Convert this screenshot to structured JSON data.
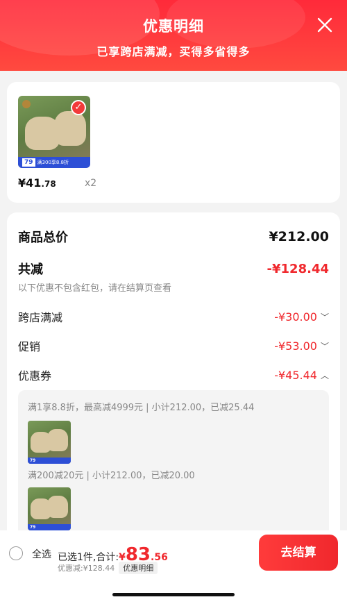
{
  "header": {
    "title": "优惠明细",
    "subtitle": "已享跨店满减，买得多省得多"
  },
  "product": {
    "price_int": "¥41",
    "price_dec": ".78",
    "quantity": "x2",
    "badge_price": "79",
    "badge_text": "满300享8.8折",
    "selected": true
  },
  "summary": {
    "total_label": "商品总价",
    "total_value": "¥212.00",
    "reduce_label": "共减",
    "reduce_value": "-¥128.44",
    "note": "以下优惠不包含红包，请在结算页查看",
    "items": [
      {
        "label": "跨店满减",
        "value": "-¥30.00",
        "chevron": "chevron-down"
      },
      {
        "label": "促销",
        "value": "-¥53.00",
        "chevron": "chevron-down"
      },
      {
        "label": "优惠券",
        "value": "-¥45.44",
        "chevron": "chevron-up"
      }
    ]
  },
  "coupons": [
    {
      "text": "满1享8.8折，最高减4999元 | 小计212.00，已减25.44",
      "thumb_price": "79"
    },
    {
      "text": "满200减20元 | 小计212.00，已减20.00",
      "thumb_price": "79"
    }
  ],
  "bottom": {
    "select_all": "全选",
    "selected_text": "已选1件,合计:",
    "yen": "¥",
    "price_int": "83",
    "price_dec": ".56",
    "discount_text": "优惠减:¥128.44",
    "detail_tag": "优惠明细",
    "checkout": "去结算"
  },
  "colors": {
    "accent_red": "#f0282d",
    "header_red": "#ff3b3d",
    "badge_blue": "#2d4fd6"
  }
}
